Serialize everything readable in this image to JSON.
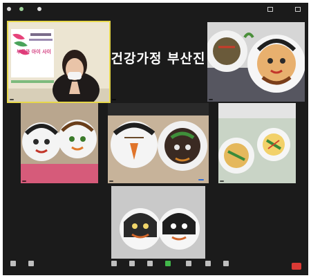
{
  "topbar": {
    "left_labels": [
      "",
      "",
      ""
    ],
    "right_labels": [
      "",
      ""
    ]
  },
  "tiles": [
    {
      "name": "",
      "banner_text": "부모와 아이 사이",
      "spotlight": true
    },
    {
      "name": "",
      "center_text": "건강가정 부산진"
    },
    {
      "name": ""
    },
    {
      "name": ""
    },
    {
      "name": ""
    },
    {
      "name": ""
    },
    {
      "name": "",
      "pill": ""
    }
  ],
  "bottombar": {
    "left": [
      "",
      ""
    ],
    "center": [
      "",
      "",
      "",
      "",
      "",
      "",
      ""
    ],
    "end": ""
  },
  "colors": {
    "background": "#1b1b1b",
    "spotlight": "#e7d84a",
    "name_pill": "#2d6bd8",
    "end_button": "#d93a35"
  }
}
